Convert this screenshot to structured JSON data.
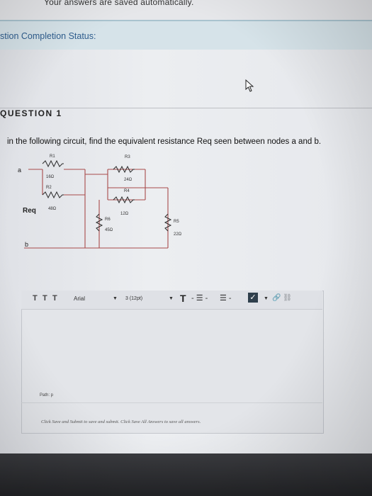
{
  "page": {
    "saved_note": "Your answers are saved automatically.",
    "status_label": "stion Completion Status:"
  },
  "question": {
    "label": "QUESTION 1",
    "text": "in the following circuit, find the equivalent resistance Req seen between nodes a and b."
  },
  "circuit": {
    "node_a": "a",
    "node_b": "b",
    "req": "Req",
    "resistors": [
      {
        "name": "R1",
        "value": "16Ω"
      },
      {
        "name": "R2",
        "value": "48Ω"
      },
      {
        "name": "R3",
        "value": "24Ω"
      },
      {
        "name": "R4",
        "value": "12Ω"
      },
      {
        "name": "R5",
        "value": "22Ω"
      },
      {
        "name": "R6",
        "value": "45Ω"
      }
    ]
  },
  "editor": {
    "format_buttons": [
      "T",
      "T",
      "T"
    ],
    "font_family": "Arial",
    "font_size": "3 (12pt)",
    "text_color_label": "T",
    "path_label": "Path: p"
  },
  "footer": {
    "hint": "Click Save and Submit to save and submit. Click Save All Answers to save all answers."
  }
}
